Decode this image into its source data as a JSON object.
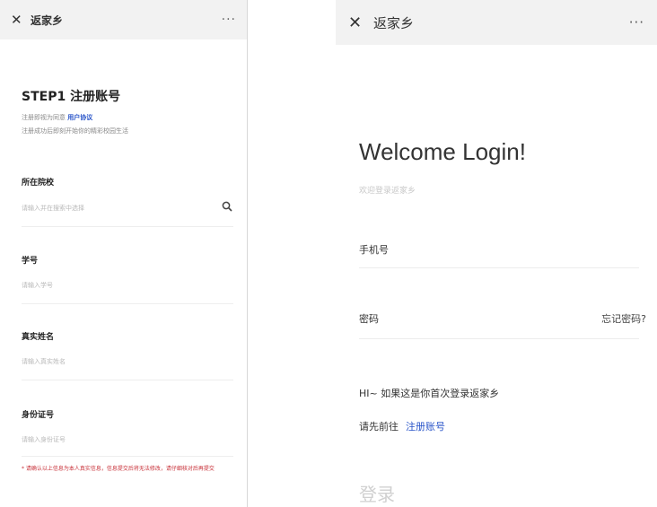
{
  "left_screen": {
    "nav": {
      "close_icon": "close-icon",
      "title": "返家乡",
      "more": "···"
    },
    "step_title": "STEP1 注册账号",
    "description_line1": "注册即视为同意",
    "description_link": "用户协议",
    "description_line2": "注册成功后即刻开始你的精彩校园生活",
    "fields": [
      {
        "label": "所在院校",
        "placeholder": "请输入并在搜索中选择"
      },
      {
        "label": "学号",
        "placeholder": "请输入学号"
      },
      {
        "label": "真实姓名",
        "placeholder": "请输入真实姓名"
      },
      {
        "label": "身份证号",
        "placeholder": "请输入身份证号"
      }
    ],
    "warning": "* 请确认以上信息为本人真实信息，信息提交后将无法修改，请仔细核对后再提交"
  },
  "right_screen": {
    "nav": {
      "close_icon": "close-icon",
      "title": "返家乡",
      "more": "···"
    },
    "welcome": "Welcome Login!",
    "subtitle": "欢迎登录返家乡",
    "phone_label": "手机号",
    "password_label": "密码",
    "forgot_link": "忘记密码?",
    "hint_line1": "HI~ 如果这是你首次登录返家乡",
    "hint_line2_prefix": "请先前往",
    "register_link": "注册账号",
    "login_button": "登录"
  },
  "colors": {
    "link": "#2a55c9",
    "warning": "#c8323a",
    "nav_bg": "#f2f2f2"
  }
}
